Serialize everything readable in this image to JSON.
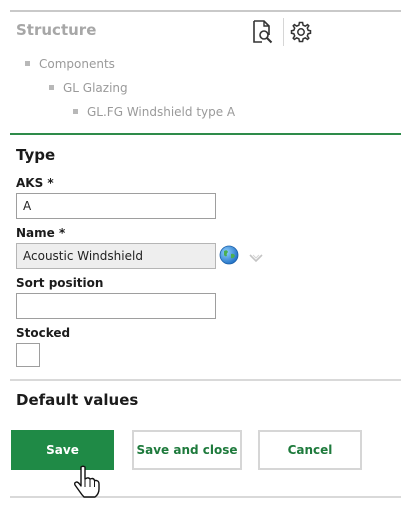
{
  "structure": {
    "title": "Structure",
    "tree": [
      {
        "label": "Components"
      },
      {
        "label": "GL Glazing"
      },
      {
        "label": "GL.FG Windshield type A"
      }
    ],
    "icons": [
      "document-search-icon",
      "gear-icon"
    ]
  },
  "type_section": {
    "title": "Type",
    "aks": {
      "label": "AKS *",
      "value": "A"
    },
    "name": {
      "label": "Name *",
      "value": "Acoustic Windshield"
    },
    "sort_position": {
      "label": "Sort position",
      "value": ""
    },
    "stocked": {
      "label": "Stocked",
      "checked": false
    }
  },
  "default_values": {
    "title": "Default values"
  },
  "actions": {
    "save": "Save",
    "save_and_close": "Save and close",
    "cancel": "Cancel"
  },
  "colors": {
    "accent_green": "#1f8a46",
    "divider_green": "#2e8b4a",
    "muted_text": "#9a9a9a"
  }
}
